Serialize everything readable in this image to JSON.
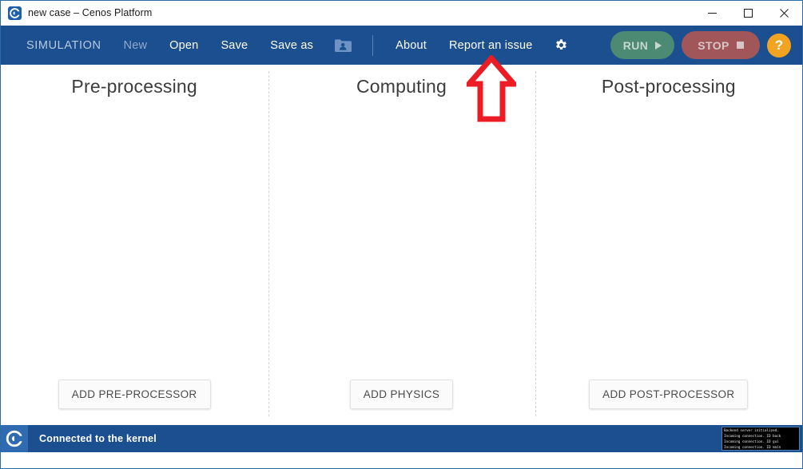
{
  "window": {
    "title": "new case – Cenos Platform",
    "app_icon": "cenos-c-logo-icon",
    "minimize_label": "Minimize",
    "maximize_label": "Maximize",
    "close_label": "Close"
  },
  "menu": {
    "brand": "SIMULATION",
    "items": [
      {
        "label": "New",
        "state": "disabled"
      },
      {
        "label": "Open",
        "state": "enabled"
      },
      {
        "label": "Save",
        "state": "enabled"
      },
      {
        "label": "Save as",
        "state": "enabled"
      }
    ],
    "folder_user_icon": "folder-user-icon",
    "right_items": [
      {
        "label": "About"
      },
      {
        "label": "Report an issue"
      }
    ],
    "settings_icon": "gear-icon",
    "run": {
      "label": "RUN",
      "icon": "play-icon",
      "color": "#4d8a74",
      "state": "disabled"
    },
    "stop": {
      "label": "STOP",
      "icon": "stop-square-icon",
      "color": "#a1575a",
      "state": "disabled"
    },
    "help": {
      "label": "?",
      "color": "#f0a422"
    }
  },
  "canvas": {
    "columns": [
      {
        "title": "Pre-processing",
        "add_button": "ADD PRE-PROCESSOR"
      },
      {
        "title": "Computing",
        "add_button": "ADD PHYSICS"
      },
      {
        "title": "Post-processing",
        "add_button": "ADD POST-PROCESSOR"
      }
    ],
    "annotation": {
      "type": "up-arrow",
      "color": "#ec1c24",
      "points_at": "Report an issue"
    }
  },
  "status": {
    "logo": "cenos-c-logo-icon",
    "text": "Connected to the kernel",
    "console_lines": [
      "Backend server initialized.",
      "Incoming connection. ID back",
      "Incoming connection. ID gui",
      "Incoming connection. ID main"
    ]
  }
}
